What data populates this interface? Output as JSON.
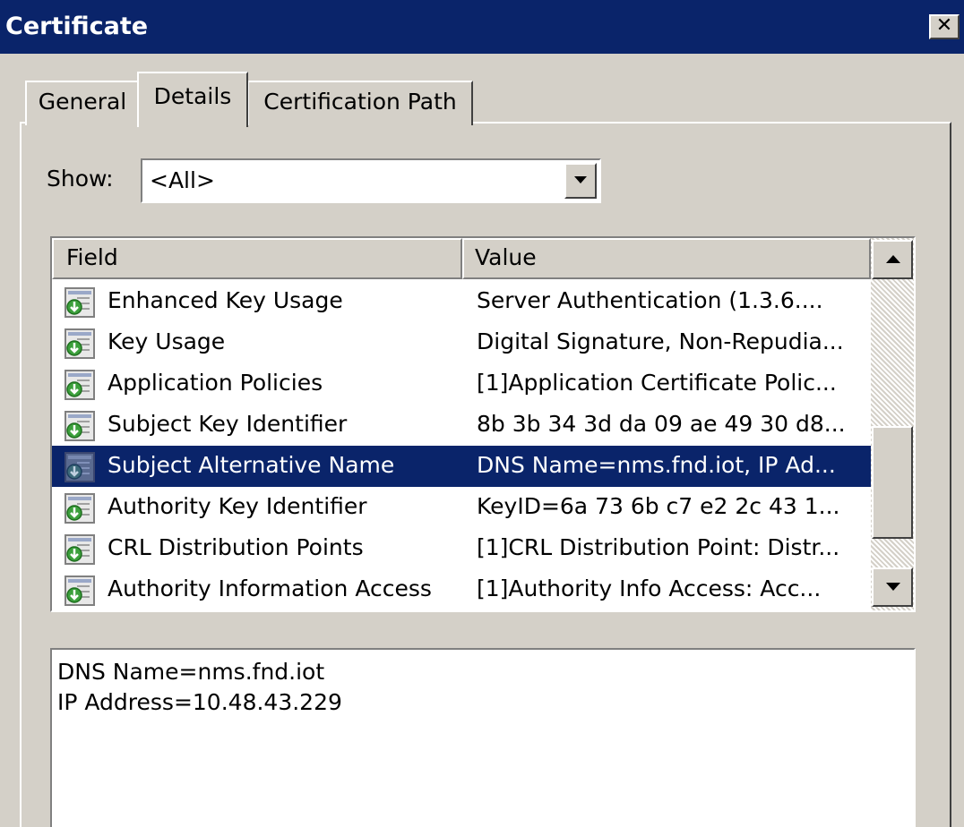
{
  "window": {
    "title": "Certificate",
    "close_label": "✕"
  },
  "tabs": [
    {
      "label": "General",
      "active": false
    },
    {
      "label": "Details",
      "active": true
    },
    {
      "label": "Certification Path",
      "active": false
    }
  ],
  "show": {
    "label": "Show:",
    "selected": "<All>"
  },
  "list": {
    "columns": [
      "Field",
      "Value"
    ],
    "rows": [
      {
        "field": "Enhanced Key Usage",
        "value": "Server Authentication (1.3.6....",
        "icon": "cert-extension-icon",
        "selected": false
      },
      {
        "field": "Key Usage",
        "value": "Digital Signature, Non-Repudia...",
        "icon": "cert-extension-icon",
        "selected": false
      },
      {
        "field": "Application Policies",
        "value": "[1]Application Certificate Polic...",
        "icon": "cert-extension-icon",
        "selected": false
      },
      {
        "field": "Subject Key Identifier",
        "value": "8b 3b 34 3d da 09 ae 49 30 d8...",
        "icon": "cert-extension-icon",
        "selected": false
      },
      {
        "field": "Subject Alternative Name",
        "value": "DNS Name=nms.fnd.iot, IP Ad...",
        "icon": "cert-extension-icon",
        "selected": true
      },
      {
        "field": "Authority Key Identifier",
        "value": "KeyID=6a 73 6b c7 e2 2c 43 1...",
        "icon": "cert-extension-icon",
        "selected": false
      },
      {
        "field": "CRL Distribution Points",
        "value": "[1]CRL Distribution Point: Distr...",
        "icon": "cert-extension-icon",
        "selected": false
      },
      {
        "field": "Authority Information Access",
        "value": "[1]Authority Info Access: Acc...",
        "icon": "cert-extension-icon",
        "selected": false
      }
    ]
  },
  "detail": {
    "lines": [
      "DNS Name=nms.fnd.iot",
      "IP Address=10.48.43.229"
    ]
  },
  "colors": {
    "titlebar": "#0a246a",
    "selection": "#0a246a",
    "face": "#d4d0c8"
  }
}
